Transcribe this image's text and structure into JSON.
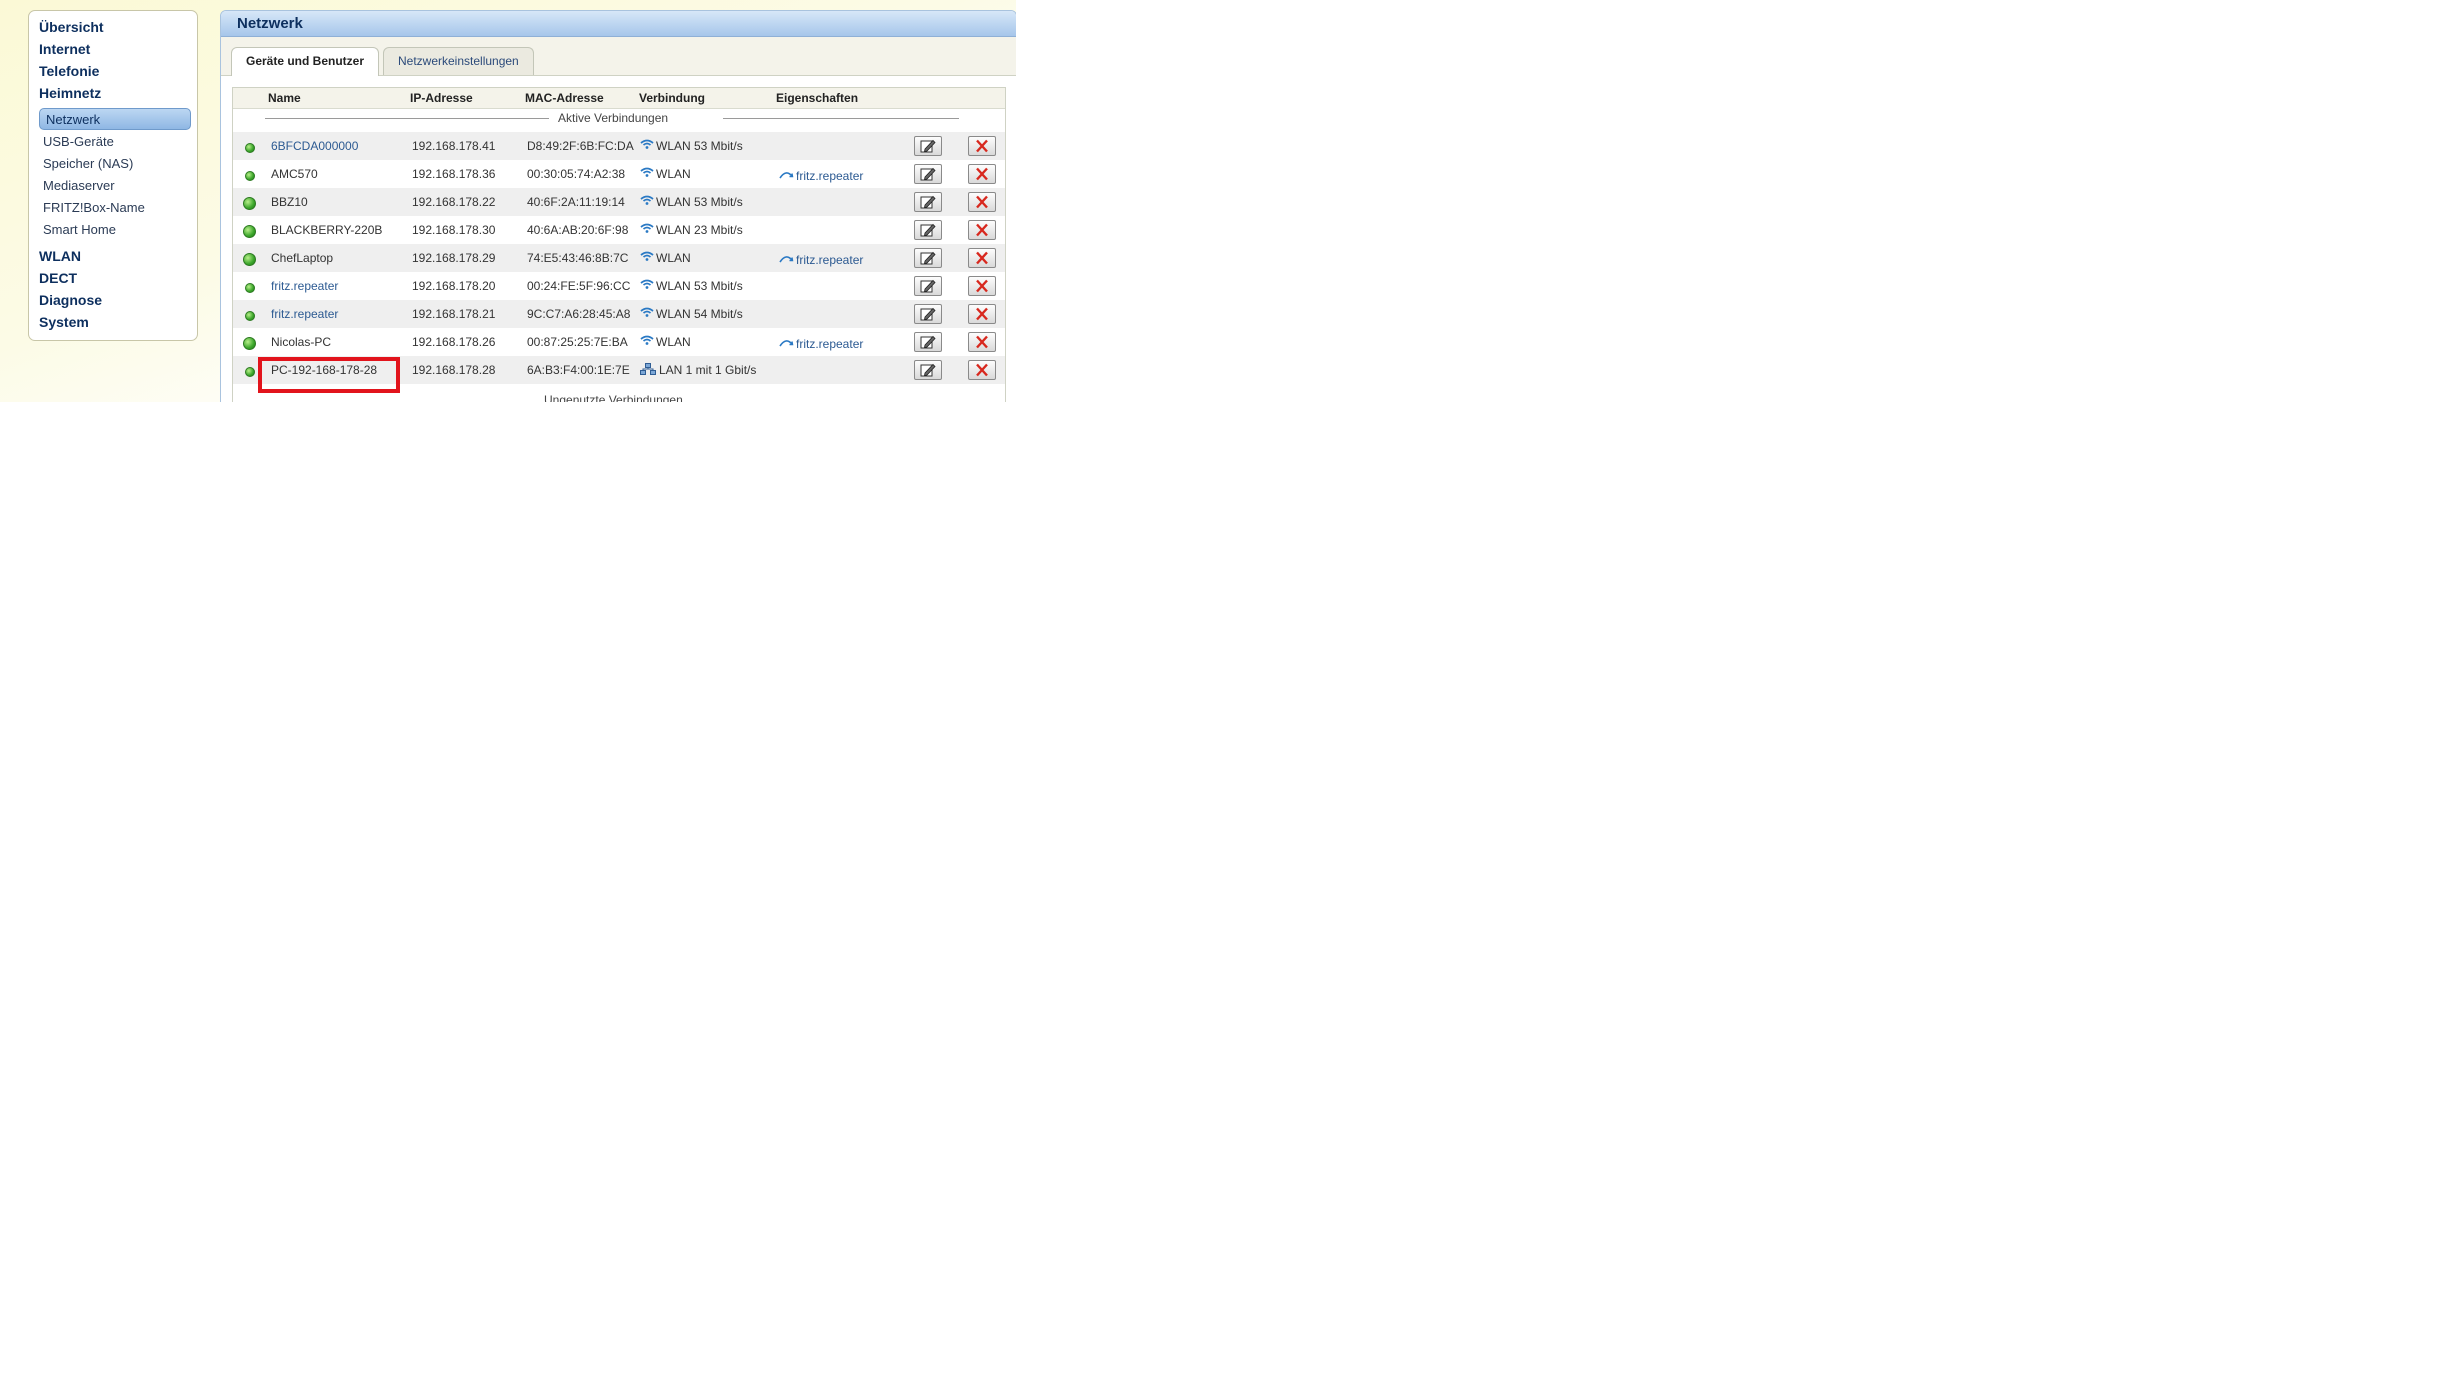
{
  "sidebar": {
    "main_top": [
      "Übersicht",
      "Internet",
      "Telefonie",
      "Heimnetz"
    ],
    "sub": [
      "Netzwerk",
      "USB-Geräte",
      "Speicher (NAS)",
      "Mediaserver",
      "FRITZ!Box-Name",
      "Smart Home"
    ],
    "main_bottom": [
      "WLAN",
      "DECT",
      "Diagnose",
      "System"
    ]
  },
  "main": {
    "title": "Netzwerk",
    "tabs": [
      "Geräte und Benutzer",
      "Netzwerkeinstellungen"
    ]
  },
  "table": {
    "headers": [
      "Name",
      "IP-Adresse",
      "MAC-Adresse",
      "Verbindung",
      "Eigenschaften"
    ],
    "section_active": "Aktive Verbindungen",
    "section_unused": "Ungenutzte Verbindungen",
    "rows": [
      {
        "name": "6BFCDA000000",
        "ip": "192.168.178.41",
        "mac": "D8:49:2F:6B:FC:DA",
        "conn": "WLAN 53 Mbit/s",
        "conn_type": "wifi",
        "prop": "",
        "link": true
      },
      {
        "name": "AMC570",
        "ip": "192.168.178.36",
        "mac": "00:30:05:74:A2:38",
        "conn": "WLAN",
        "conn_type": "wifi",
        "prop": "fritz.repeater",
        "link": false
      },
      {
        "name": "BBZ10",
        "ip": "192.168.178.22",
        "mac": "40:6F:2A:11:19:14",
        "conn": "WLAN 53 Mbit/s",
        "conn_type": "wifi",
        "prop": "",
        "link": false
      },
      {
        "name": "BLACKBERRY-220B",
        "ip": "192.168.178.30",
        "mac": "40:6A:AB:20:6F:98",
        "conn": "WLAN 23 Mbit/s",
        "conn_type": "wifi",
        "prop": "",
        "link": false
      },
      {
        "name": "ChefLaptop",
        "ip": "192.168.178.29",
        "mac": "74:E5:43:46:8B:7C",
        "conn": "WLAN",
        "conn_type": "wifi",
        "prop": "fritz.repeater",
        "link": false
      },
      {
        "name": "fritz.repeater",
        "ip": "192.168.178.20",
        "mac": "00:24:FE:5F:96:CC",
        "conn": "WLAN 53 Mbit/s",
        "conn_type": "wifi",
        "prop": "",
        "link": true
      },
      {
        "name": "fritz.repeater",
        "ip": "192.168.178.21",
        "mac": "9C:C7:A6:28:45:A8",
        "conn": "WLAN 54 Mbit/s",
        "conn_type": "wifi",
        "prop": "",
        "link": true
      },
      {
        "name": "Nicolas-PC",
        "ip": "192.168.178.26",
        "mac": "00:87:25:25:7E:BA",
        "conn": "WLAN",
        "conn_type": "wifi",
        "prop": "fritz.repeater",
        "link": false
      },
      {
        "name": "PC-192-168-178-28",
        "ip": "192.168.178.28",
        "mac": "6A:B3:F4:00:1E:7E",
        "conn": "LAN 1 mit 1 Gbit/s",
        "conn_type": "lan",
        "prop": "",
        "link": false
      }
    ]
  },
  "colors": {
    "highlight": "#e2141c",
    "link": "#2c5a92",
    "nav": "#0d2f5e"
  }
}
